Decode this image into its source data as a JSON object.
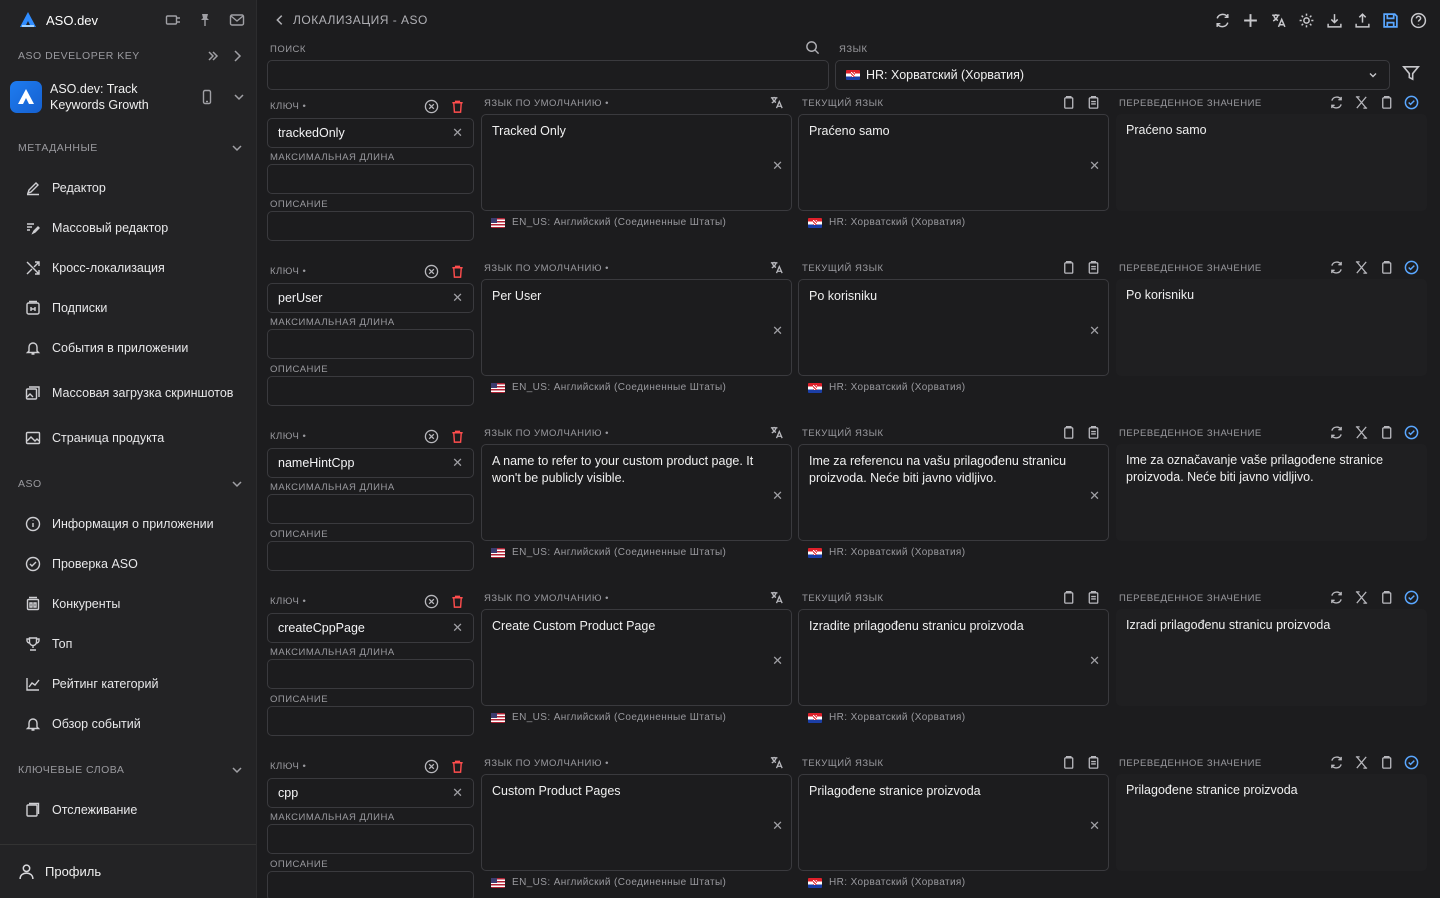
{
  "app": {
    "name": "ASO.dev"
  },
  "sidebar": {
    "dev_key_label": "ASO DEVELOPER KEY",
    "app_title": "ASO.dev: Track Keywords Growth",
    "sections": {
      "metadata": "МЕТАДАННЫЕ",
      "aso": "ASO",
      "keywords": "КЛЮЧЕВЫЕ СЛОВА"
    },
    "metadata_items": [
      {
        "label": "Редактор",
        "icon": "pencil-icon"
      },
      {
        "label": "Массовый редактор",
        "icon": "bulk-edit-icon"
      },
      {
        "label": "Кросс-локализация",
        "icon": "cross-arrows-icon"
      },
      {
        "label": "Подписки",
        "icon": "subscriptions-icon"
      },
      {
        "label": "События в приложении",
        "icon": "bell-icon"
      },
      {
        "label": "Массовая загрузка скриншотов",
        "icon": "images-icon"
      },
      {
        "label": "Страница продукта",
        "icon": "image-icon"
      }
    ],
    "aso_items": [
      {
        "label": "Информация о приложении",
        "icon": "info-icon"
      },
      {
        "label": "Проверка ASO",
        "icon": "check-circle-icon"
      },
      {
        "label": "Конкуренты",
        "icon": "competitors-icon"
      },
      {
        "label": "Топ",
        "icon": "trophy-icon"
      },
      {
        "label": "Рейтинг категорий",
        "icon": "chart-icon"
      },
      {
        "label": "Обзор событий",
        "icon": "bell-icon"
      }
    ],
    "keywords_items": [
      {
        "label": "Отслеживание",
        "icon": "bookmark-icon"
      }
    ],
    "profile_label": "Профиль"
  },
  "header": {
    "breadcrumb": "ЛОКАЛИЗАЦИЯ - ASO"
  },
  "filters": {
    "search_label": "ПОИСК",
    "search_value": "",
    "language_label": "ЯЗЫК",
    "language_value": "HR: Хорватский (Хорватия)"
  },
  "labels": {
    "key": "КЛЮЧ •",
    "max_length": "МАКСИМАЛЬНАЯ ДЛИНА",
    "description": "ОПИСАНИЕ",
    "default_lang": "ЯЗЫК ПО УМОЛЧАНИЮ •",
    "current_lang": "ТЕКУЩИЙ ЯЗЫК",
    "translated": "ПЕРЕВЕДЕННОЕ ЗНАЧЕНИЕ",
    "default_locale": "EN_US: Английский (Соединенные Штаты)",
    "current_locale": "HR: Хорватский (Хорватия)"
  },
  "rows": [
    {
      "key": "trackedOnly",
      "default": "Tracked Only",
      "current": "Praćeno samo",
      "translated": "Praćeno samo"
    },
    {
      "key": "perUser",
      "default": "Per User",
      "current": "Po korisniku",
      "translated": "Po korisniku"
    },
    {
      "key": "nameHintCpp",
      "default": "A name to refer to your custom product page. It won't be publicly visible.",
      "current": "Ime za referencu na vašu prilagođenu stranicu proizvoda. Neće biti javno vidljivo.",
      "translated": "Ime za označavanje vaše prilagođene stranice proizvoda. Neće biti javno vidljivo."
    },
    {
      "key": "createCppPage",
      "default": "Create Custom Product Page",
      "current": "Izradite prilagođenu stranicu proizvoda",
      "translated": "Izradi prilagođenu stranicu proizvoda"
    },
    {
      "key": "cpp",
      "default": "Custom Product Pages",
      "current": "Prilagođene stranice proizvoda",
      "translated": "Prilagođene stranice proizvoda"
    }
  ],
  "colors": {
    "background": "#1c1c1e",
    "sidebar": "#232325",
    "accent": "#5aa7ff",
    "danger": "#ff4d4d"
  }
}
